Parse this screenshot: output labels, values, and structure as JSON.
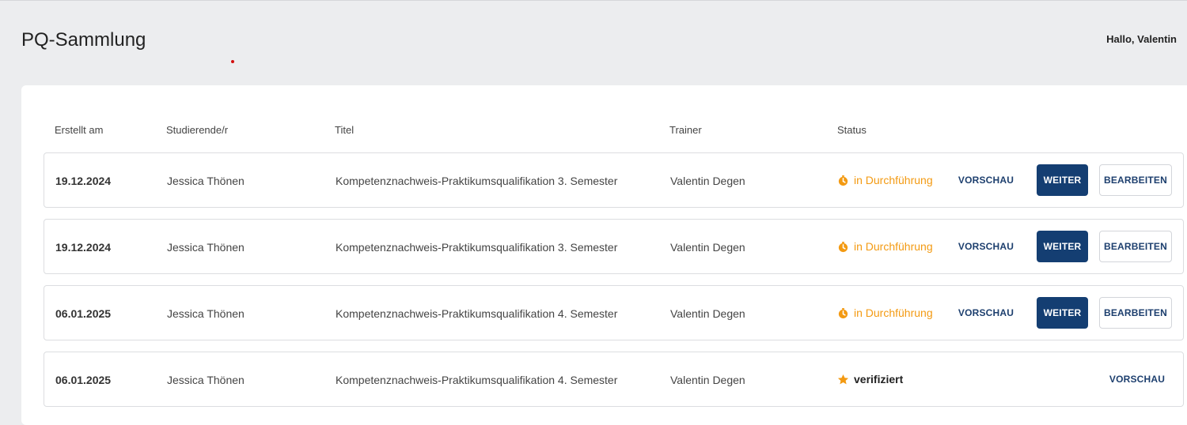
{
  "header": {
    "title": "PQ-Sammlung",
    "greeting": "Hallo, Valentin"
  },
  "table": {
    "columns": [
      "Erstellt am",
      "Studierende/r",
      "Titel",
      "Trainer",
      "Status"
    ],
    "rows": [
      {
        "date": "19.12.2024",
        "student": "Jessica Thönen",
        "title": "Kompetenznachweis-Praktikumsqualifikation 3. Semester",
        "trainer": "Valentin Degen",
        "status": "in Durchführung",
        "status_icon": "timer-icon",
        "actions": [
          "VORSCHAU",
          "WEITER",
          "BEARBEITEN"
        ]
      },
      {
        "date": "19.12.2024",
        "student": "Jessica Thönen",
        "title": "Kompetenznachweis-Praktikumsqualifikation 3. Semester",
        "trainer": "Valentin Degen",
        "status": "in Durchführung",
        "status_icon": "timer-icon",
        "actions": [
          "VORSCHAU",
          "WEITER",
          "BEARBEITEN"
        ]
      },
      {
        "date": "06.01.2025",
        "student": "Jessica Thönen",
        "title": "Kompetenznachweis-Praktikumsqualifikation 4. Semester",
        "trainer": "Valentin Degen",
        "status": "in Durchführung",
        "status_icon": "timer-icon",
        "actions": [
          "VORSCHAU",
          "WEITER",
          "BEARBEITEN"
        ]
      },
      {
        "date": "06.01.2025",
        "student": "Jessica Thönen",
        "title": "Kompetenznachweis-Praktikumsqualifikation 4. Semester",
        "trainer": "Valentin Degen",
        "status": "verifiziert",
        "status_icon": "star-icon",
        "actions": [
          "VORSCHAU"
        ]
      }
    ]
  },
  "colors": {
    "background": "#ecedef",
    "primary": "#143e72",
    "in_progress": "#f39a12",
    "verified_icon": "#f39a12"
  }
}
